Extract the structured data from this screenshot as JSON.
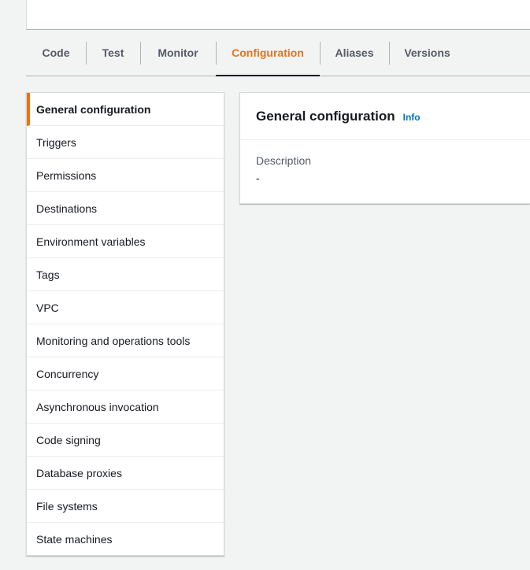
{
  "tabs": [
    {
      "label": "Code"
    },
    {
      "label": "Test"
    },
    {
      "label": "Monitor"
    },
    {
      "label": "Configuration"
    },
    {
      "label": "Aliases"
    },
    {
      "label": "Versions"
    }
  ],
  "active_tab": "Configuration",
  "sidenav": {
    "items": [
      {
        "label": "General configuration"
      },
      {
        "label": "Triggers"
      },
      {
        "label": "Permissions"
      },
      {
        "label": "Destinations"
      },
      {
        "label": "Environment variables"
      },
      {
        "label": "Tags"
      },
      {
        "label": "VPC"
      },
      {
        "label": "Monitoring and operations tools"
      },
      {
        "label": "Concurrency"
      },
      {
        "label": "Asynchronous invocation"
      },
      {
        "label": "Code signing"
      },
      {
        "label": "Database proxies"
      },
      {
        "label": "File systems"
      },
      {
        "label": "State machines"
      }
    ],
    "active": "General configuration"
  },
  "panel": {
    "title": "General configuration",
    "info_label": "Info",
    "description_label": "Description",
    "description_value": "-"
  },
  "colors": {
    "accent": "#ec7211",
    "link": "#0073bb",
    "background": "#f2f3f3"
  }
}
